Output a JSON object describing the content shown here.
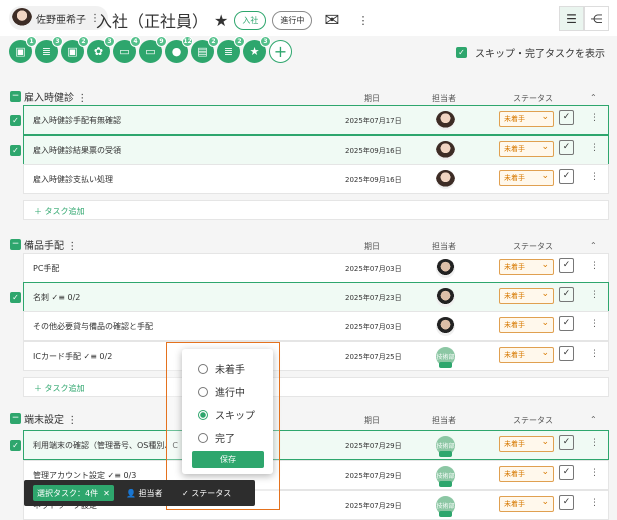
{
  "header": {
    "person": "佐野亜希子",
    "title": "入社（正社員）",
    "star": "★",
    "tag1": "入社",
    "tag2": "進行中",
    "mail": "✉",
    "more": "⋮",
    "view_list": "☰",
    "view_tree": "⋲"
  },
  "task_icons": [
    {
      "icon": "card-icon",
      "badge": "1"
    },
    {
      "icon": "doc-icon",
      "badge": "3"
    },
    {
      "icon": "card-icon",
      "badge": "2"
    },
    {
      "icon": "gear-icon",
      "badge": "3"
    },
    {
      "icon": "laptop-icon",
      "badge": "4"
    },
    {
      "icon": "laptop-icon",
      "badge": "9"
    },
    {
      "icon": "person-icon",
      "badge": "12"
    },
    {
      "icon": "file-icon",
      "badge": "2"
    },
    {
      "icon": "doc-icon",
      "badge": "2"
    },
    {
      "icon": "star-icon",
      "badge": "3"
    }
  ],
  "skip_label": "スキップ・完了タスクを表示",
  "columns": {
    "date": "期日",
    "assignee": "担当者",
    "status": "ステータス"
  },
  "sections": [
    {
      "name": "雇入時健診",
      "rows": [
        {
          "name": "雇入時健診手配有無確認",
          "date": "2025年07月17日",
          "status": "未着手"
        },
        {
          "name": "雇入時健診結果票の受領",
          "date": "2025年09月16日",
          "status": "未着手"
        },
        {
          "name": "雇入時健診支払い処理",
          "date": "2025年09月16日",
          "status": "未着手"
        }
      ]
    },
    {
      "name": "備品手配",
      "rows": [
        {
          "name": "PC手配",
          "date": "2025年07月03日",
          "status": "未着手"
        },
        {
          "name": "名刺 ✓≡ 0/2",
          "date": "2025年07月23日",
          "status": "未着手"
        },
        {
          "name": "その他必要貸与備品の確認と手配",
          "date": "2025年07月03日",
          "status": "未着手"
        },
        {
          "name": "ICカード手配 ✓≡ 0/2",
          "date": "2025年07月25日",
          "status": "未着手",
          "av_label": "技術部"
        }
      ]
    },
    {
      "name": "端末設定",
      "rows": [
        {
          "name": "利用端末の確認（管理番号、OS種別、C",
          "date": "2025年07月29日",
          "status": "未着手",
          "av_label": "技術部"
        },
        {
          "name": "管理アカウント設定 ✓≡ 0/3",
          "date": "2025年07月29日",
          "status": "未着手",
          "av_label": "技術部"
        },
        {
          "name": "ネットワーク設定",
          "date": "2025年07月29日",
          "status": "未着手",
          "av_label": "技術部"
        }
      ]
    }
  ],
  "add_task": "＋ タスク追加",
  "status_menu": {
    "options": [
      "未着手",
      "進行中",
      "スキップ",
      "完了"
    ],
    "selected": "スキップ",
    "save": "保存"
  },
  "bottom_bar": {
    "selected": "選択タスク：4件",
    "close": "✕",
    "assignee": "担当者",
    "status": "ステータス"
  }
}
